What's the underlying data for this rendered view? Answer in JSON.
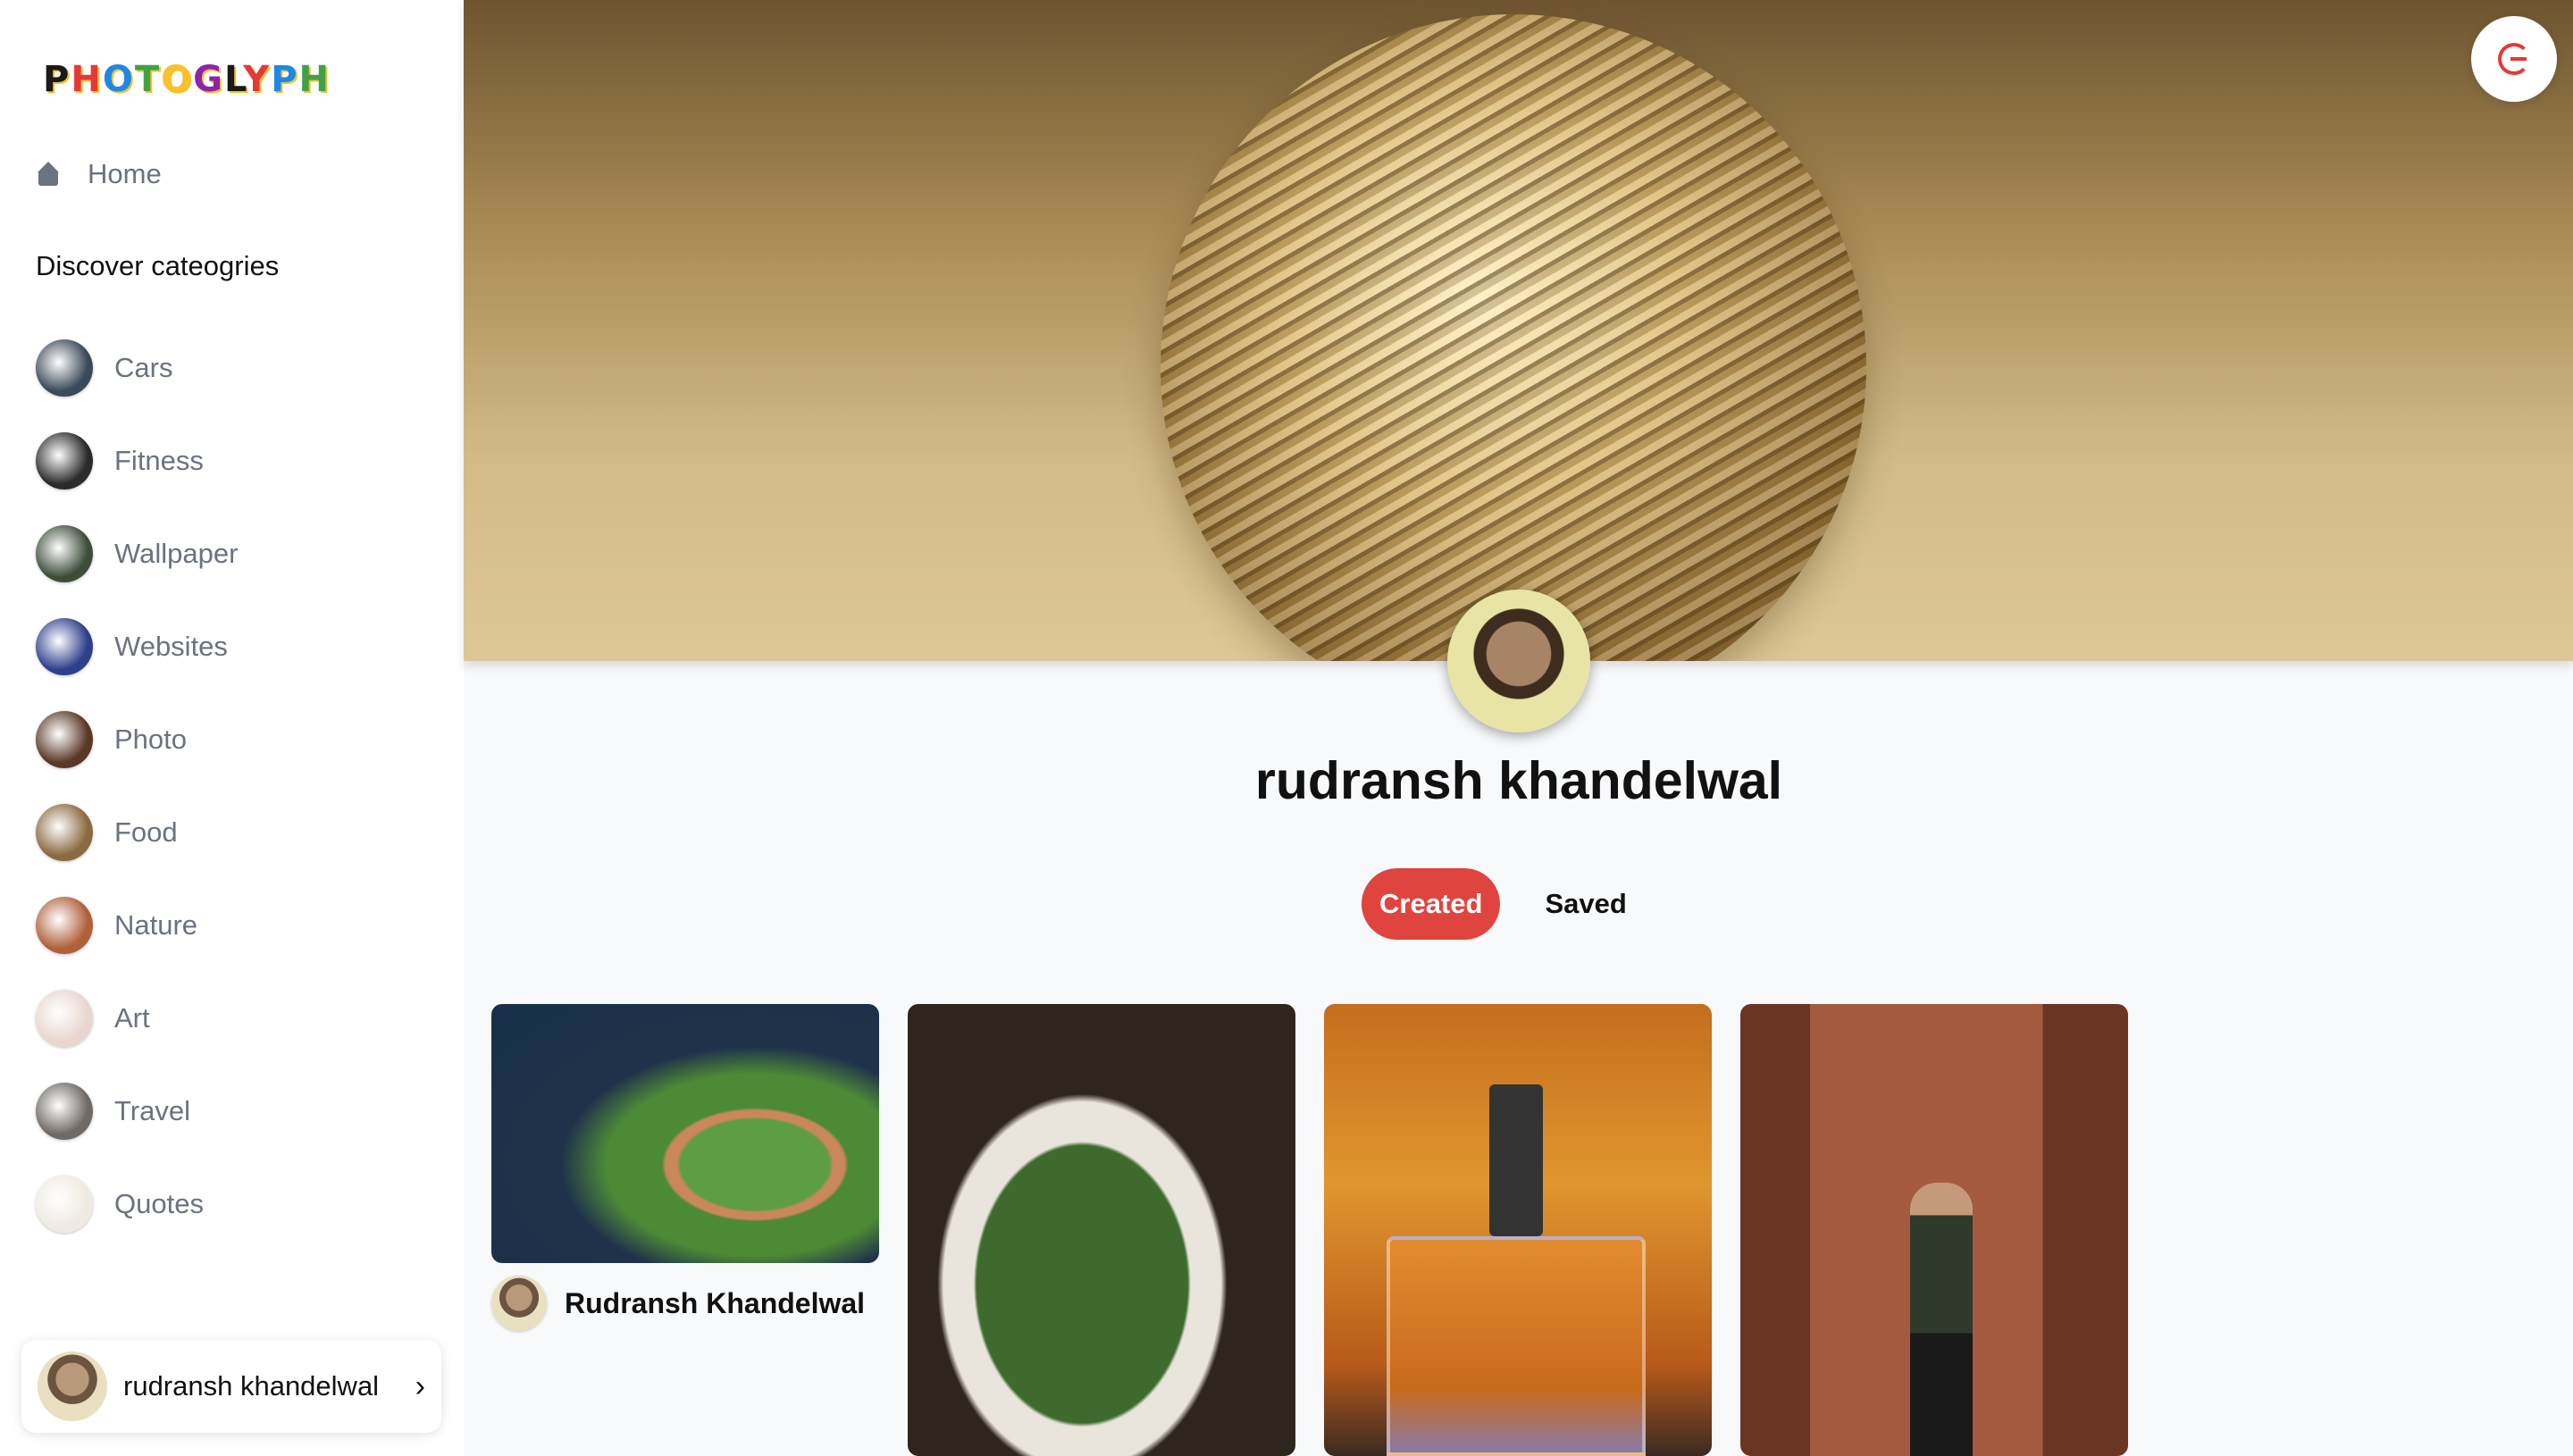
{
  "app": {
    "logo_text": "PHOTOGLYPH",
    "logo_colors": [
      "#1a1a1a",
      "#e53935",
      "#1e88e5",
      "#43a047",
      "#fbc02d",
      "#8e24aa"
    ]
  },
  "sidebar": {
    "home_label": "Home",
    "discover_heading": "Discover cateogries",
    "categories": [
      {
        "label": "Cars",
        "thumb": "#3b4a5a"
      },
      {
        "label": "Fitness",
        "thumb": "#2b2b2b"
      },
      {
        "label": "Wallpaper",
        "thumb": "#3e4d3a"
      },
      {
        "label": "Websites",
        "thumb": "#2f3f8c"
      },
      {
        "label": "Photo",
        "thumb": "#5a3826"
      },
      {
        "label": "Food",
        "thumb": "#8a6a40"
      },
      {
        "label": "Nature",
        "thumb": "#b0603a"
      },
      {
        "label": "Art",
        "thumb": "#e9d6d0"
      },
      {
        "label": "Travel",
        "thumb": "#6f6a66"
      },
      {
        "label": "Quotes",
        "thumb": "#efeae2"
      }
    ],
    "user_name": "rudransh khandelwal"
  },
  "profile": {
    "name": "rudransh khandelwal",
    "tabs": {
      "created": "Created",
      "saved": "Saved"
    },
    "active_tab": "Created",
    "accent": "#e0443f"
  },
  "pins": [
    {
      "subject": "baseball-stadium",
      "author": "Rudransh Khandelwal",
      "colors": [
        "#1b3550",
        "#3f7a3a",
        "#6fa84a"
      ]
    },
    {
      "subject": "green-beans-salad",
      "colors": [
        "#3a2e22",
        "#2f5a2a",
        "#e8e4de"
      ]
    },
    {
      "subject": "perfume-bottle",
      "colors": [
        "#d9862c",
        "#b8621a",
        "#2a2a2a"
      ]
    },
    {
      "subject": "man-at-brick-building",
      "colors": [
        "#7a3f2e",
        "#a0563c",
        "#5a3a2a"
      ]
    }
  ]
}
